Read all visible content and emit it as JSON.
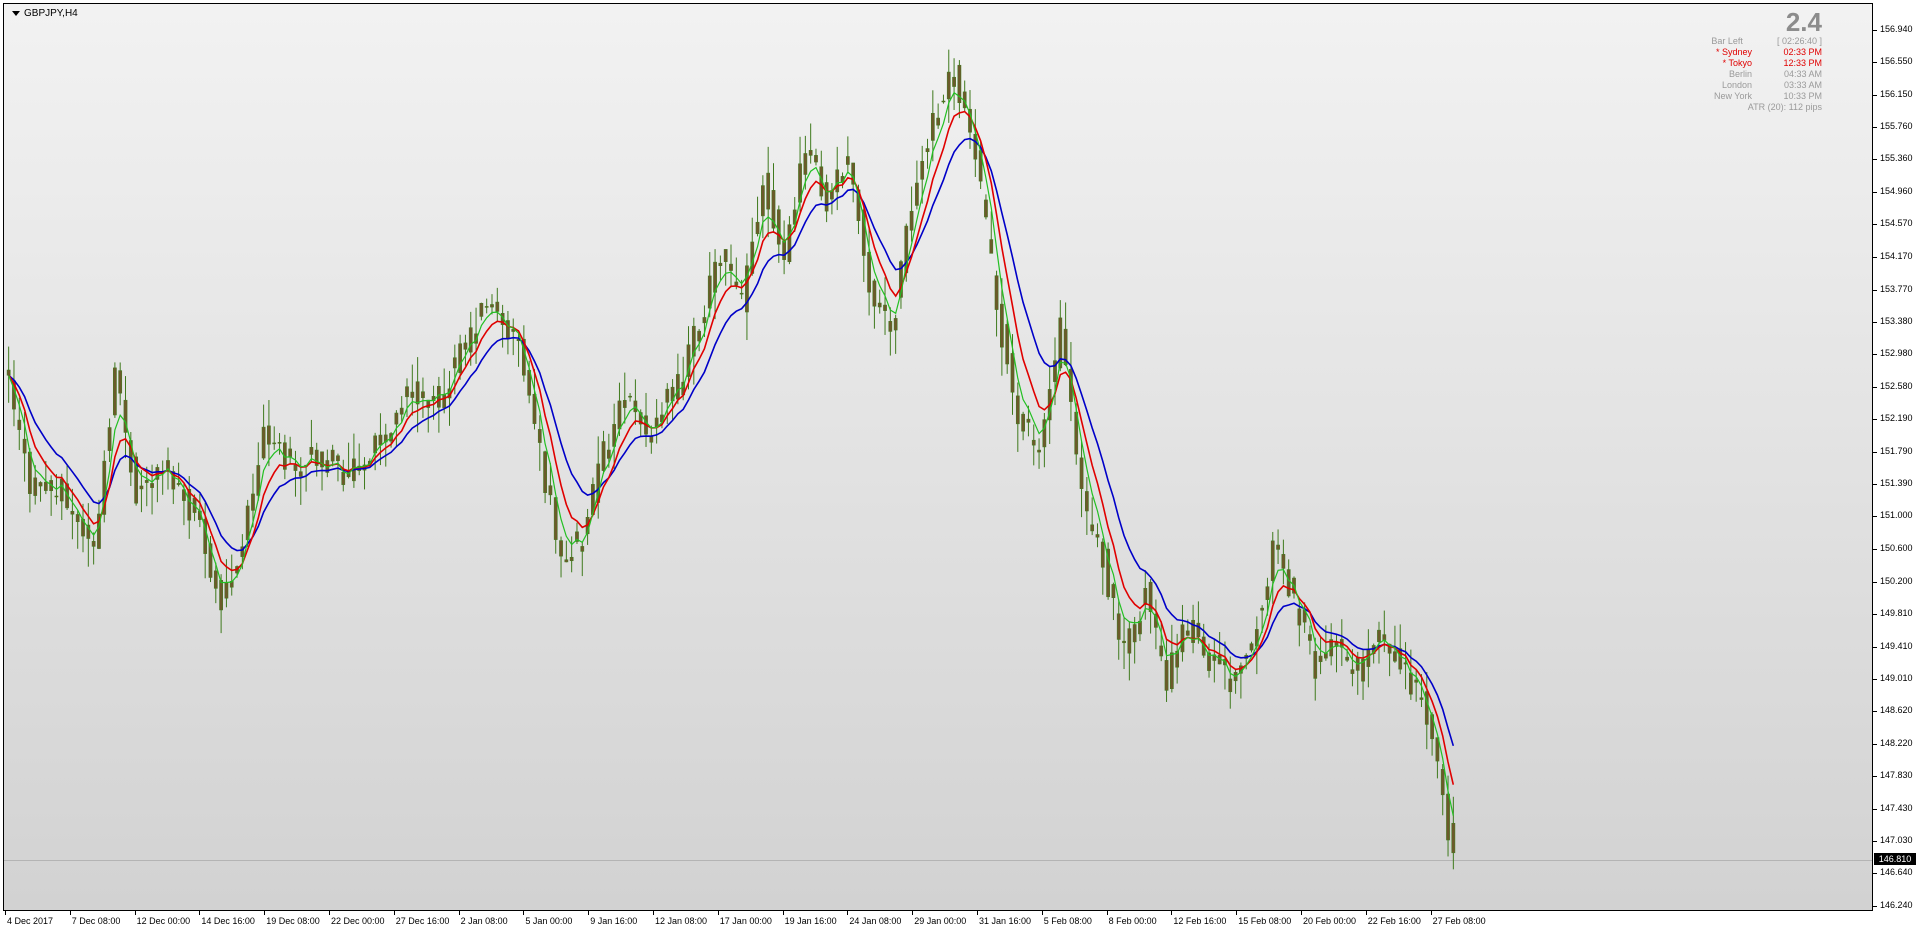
{
  "window": {
    "symbol_title": "GBPJPY,H4"
  },
  "info_panel": {
    "spread": "2.4",
    "rows": [
      {
        "label": "Bar Left",
        "value": "[ 02:26:40 ]",
        "color": "#9a9a9a"
      },
      {
        "label": "* Sydney",
        "value": "02:33 PM",
        "color": "#e00000"
      },
      {
        "label": "* Tokyo",
        "value": "12:33 PM",
        "color": "#e00000"
      },
      {
        "label": "Berlin",
        "value": "04:33 AM",
        "color": "#9a9a9a"
      },
      {
        "label": "London",
        "value": "03:33 AM",
        "color": "#9a9a9a"
      },
      {
        "label": "New York",
        "value": "10:33 PM",
        "color": "#9a9a9a"
      }
    ],
    "atr": "ATR (20): 112 pips"
  },
  "current_price": {
    "value": "146.810",
    "numeric": 146.81
  },
  "colors": {
    "candle_body": "#6b5a2a",
    "candle_wick": "#3f7a1d",
    "ma_fast": "#22c022",
    "ma_mid": "#e00000",
    "ma_slow": "#0000c8"
  },
  "chart_data": {
    "type": "candlestick",
    "symbol": "GBPJPY",
    "timeframe": "H4",
    "ylim": [
      146.24,
      157.1
    ],
    "y_ticks": [
      "156.940",
      "156.550",
      "156.150",
      "155.760",
      "155.360",
      "154.960",
      "154.570",
      "154.170",
      "153.770",
      "153.380",
      "152.980",
      "152.580",
      "152.190",
      "151.790",
      "151.390",
      "151.000",
      "150.600",
      "150.200",
      "149.810",
      "149.410",
      "149.010",
      "148.620",
      "148.220",
      "147.830",
      "147.430",
      "147.030",
      "146.640",
      "146.240"
    ],
    "x_ticks": [
      "4 Dec 2017",
      "7 Dec 08:00",
      "12 Dec 00:00",
      "14 Dec 16:00",
      "19 Dec 08:00",
      "22 Dec 00:00",
      "27 Dec 16:00",
      "2 Jan 08:00",
      "5 Jan 00:00",
      "9 Jan 16:00",
      "12 Jan 08:00",
      "17 Jan 00:00",
      "19 Jan 16:00",
      "24 Jan 08:00",
      "29 Jan 00:00",
      "31 Jan 16:00",
      "5 Feb 08:00",
      "8 Feb 00:00",
      "12 Feb 16:00",
      "15 Feb 08:00",
      "20 Feb 00:00",
      "22 Feb 16:00",
      "27 Feb 08:00"
    ],
    "close_path": [
      [
        0,
        152.6
      ],
      [
        4,
        151.4
      ],
      [
        10,
        151.3
      ],
      [
        16,
        150.6
      ],
      [
        20,
        152.8
      ],
      [
        24,
        151.3
      ],
      [
        30,
        151.6
      ],
      [
        36,
        150.9
      ],
      [
        40,
        149.9
      ],
      [
        44,
        150.7
      ],
      [
        48,
        152.0
      ],
      [
        54,
        151.6
      ],
      [
        58,
        151.8
      ],
      [
        64,
        151.5
      ],
      [
        70,
        151.9
      ],
      [
        76,
        152.6
      ],
      [
        80,
        152.3
      ],
      [
        86,
        153.1
      ],
      [
        90,
        153.6
      ],
      [
        96,
        153.1
      ],
      [
        100,
        151.8
      ],
      [
        104,
        150.5
      ],
      [
        108,
        150.7
      ],
      [
        112,
        151.8
      ],
      [
        116,
        152.5
      ],
      [
        120,
        152.0
      ],
      [
        126,
        152.6
      ],
      [
        130,
        153.4
      ],
      [
        134,
        154.2
      ],
      [
        138,
        153.6
      ],
      [
        142,
        155.1
      ],
      [
        146,
        154.2
      ],
      [
        150,
        155.6
      ],
      [
        154,
        154.8
      ],
      [
        158,
        155.4
      ],
      [
        162,
        153.9
      ],
      [
        166,
        153.2
      ],
      [
        170,
        154.8
      ],
      [
        174,
        155.9
      ],
      [
        178,
        156.5
      ],
      [
        182,
        155.4
      ],
      [
        186,
        153.6
      ],
      [
        190,
        152.2
      ],
      [
        194,
        151.8
      ],
      [
        198,
        153.3
      ],
      [
        202,
        151.2
      ],
      [
        206,
        150.5
      ],
      [
        210,
        149.3
      ],
      [
        214,
        150.1
      ],
      [
        218,
        149.0
      ],
      [
        222,
        149.7
      ],
      [
        226,
        149.3
      ],
      [
        230,
        149.0
      ],
      [
        234,
        149.5
      ],
      [
        238,
        150.6
      ],
      [
        242,
        150.0
      ],
      [
        246,
        149.2
      ],
      [
        250,
        149.4
      ],
      [
        254,
        149.1
      ],
      [
        258,
        149.5
      ],
      [
        262,
        149.2
      ],
      [
        266,
        148.8
      ],
      [
        270,
        147.6
      ],
      [
        272,
        146.8
      ]
    ]
  }
}
